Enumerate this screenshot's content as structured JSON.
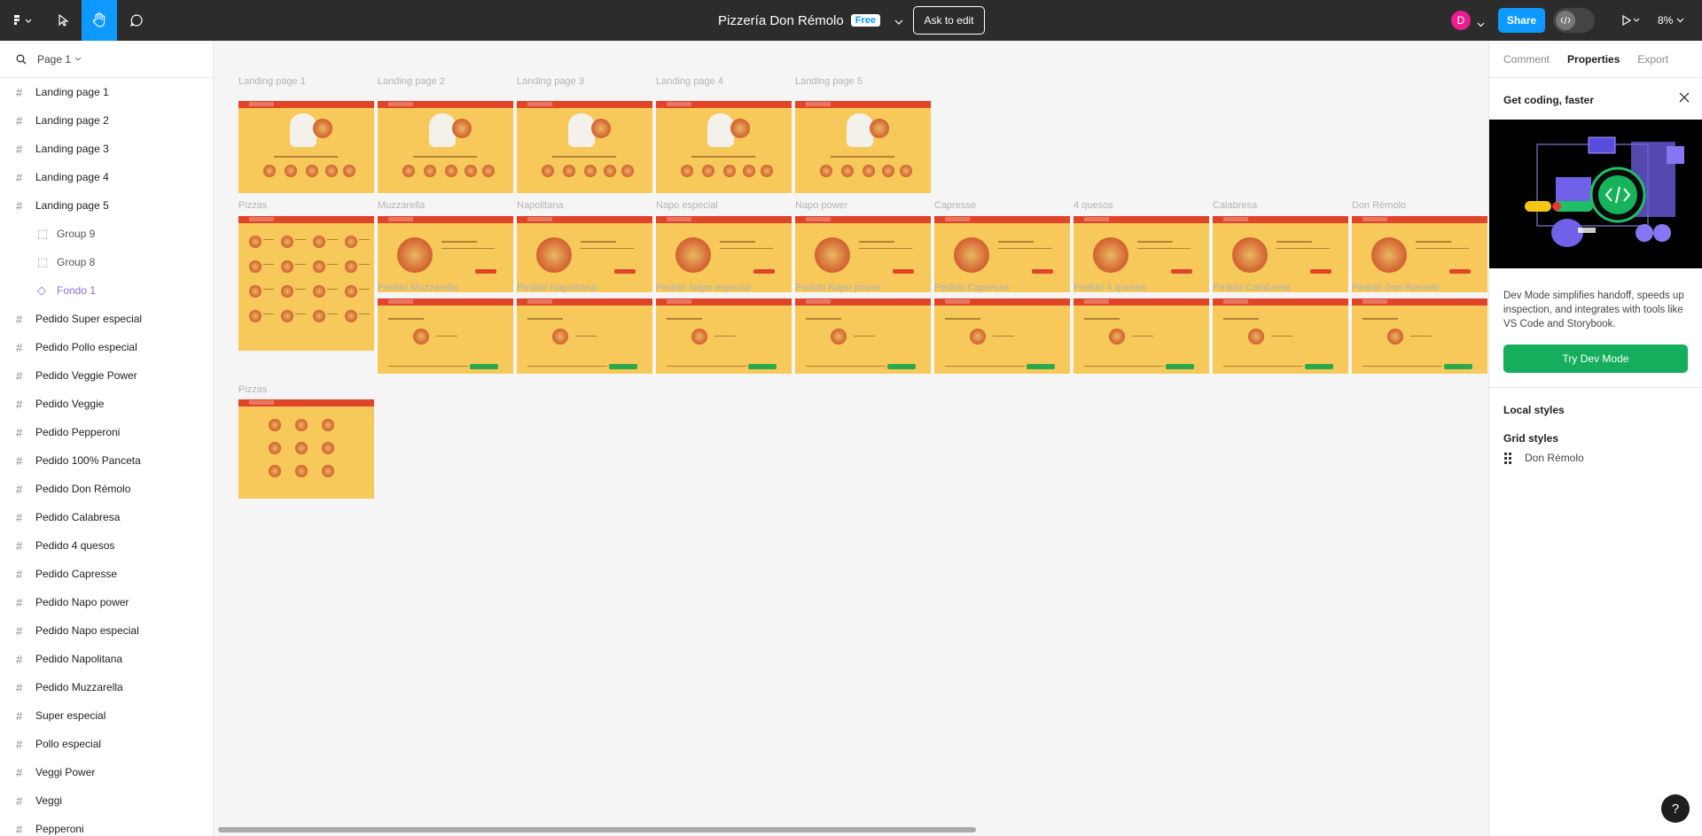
{
  "topbar": {
    "file_title": "Pizzería Don Rémolo",
    "badge": "Free",
    "ask_to_edit": "Ask to edit",
    "avatar_initial": "D",
    "share": "Share",
    "zoom": "8%"
  },
  "left": {
    "page_selector": "Page 1",
    "layers": [
      {
        "label": "Landing page 1",
        "kind": "frame"
      },
      {
        "label": "Landing page 2",
        "kind": "frame"
      },
      {
        "label": "Landing page 3",
        "kind": "frame"
      },
      {
        "label": "Landing page 4",
        "kind": "frame"
      },
      {
        "label": "Landing page 5",
        "kind": "frame"
      },
      {
        "label": "Group 9",
        "kind": "group"
      },
      {
        "label": "Group 8",
        "kind": "group"
      },
      {
        "label": "Fondo 1",
        "kind": "component"
      },
      {
        "label": "Pedido Super especial",
        "kind": "frame"
      },
      {
        "label": "Pedido Pollo especial",
        "kind": "frame"
      },
      {
        "label": "Pedido Veggie Power",
        "kind": "frame"
      },
      {
        "label": "Pedido Veggie",
        "kind": "frame"
      },
      {
        "label": "Pedido Pepperoni",
        "kind": "frame"
      },
      {
        "label": "Pedido 100% Panceta",
        "kind": "frame"
      },
      {
        "label": "Pedido Don Rémolo",
        "kind": "frame"
      },
      {
        "label": "Pedido Calabresa",
        "kind": "frame"
      },
      {
        "label": "Pedido 4 quesos",
        "kind": "frame"
      },
      {
        "label": "Pedido Capresse",
        "kind": "frame"
      },
      {
        "label": "Pedido Napo power",
        "kind": "frame"
      },
      {
        "label": "Pedido Napo especial",
        "kind": "frame"
      },
      {
        "label": "Pedido Napolitana",
        "kind": "frame"
      },
      {
        "label": "Pedido Muzzarella",
        "kind": "frame"
      },
      {
        "label": "Super especial",
        "kind": "frame"
      },
      {
        "label": "Pollo especial",
        "kind": "frame"
      },
      {
        "label": "Veggi Power",
        "kind": "frame"
      },
      {
        "label": "Veggi",
        "kind": "frame"
      },
      {
        "label": "Pepperoni",
        "kind": "frame"
      }
    ]
  },
  "canvas": {
    "row1_labels": [
      "Landing page 1",
      "Landing page 2",
      "Landing page 3",
      "Landing page 4",
      "Landing page 5"
    ],
    "row2_labels": [
      "Pizzas",
      "Muzzarella",
      "Napolitana",
      "Napo especial",
      "Napo power",
      "Capresse",
      "4 quesos",
      "Calabresa",
      "Don Rémolo"
    ],
    "row3_labels": [
      "Pedido Muzzarella",
      "Pedido Napolitana",
      "Pedido Napo especial",
      "Pedido Napo power",
      "Pedido Capresse",
      "Pedido 4 quesos",
      "Pedido Calabresa",
      "Pedido Don Rémolo"
    ],
    "row4_labels": [
      "Pizzas"
    ]
  },
  "right": {
    "tabs": [
      "Comment",
      "Properties",
      "Export"
    ],
    "active_tab": "Properties",
    "promo_title": "Get coding, faster",
    "promo_text": "Dev Mode simplifies handoff, speeds up inspection, and integrates with tools like VS Code and Storybook.",
    "try_button": "Try Dev Mode",
    "local_styles": "Local styles",
    "grid_styles": "Grid styles",
    "grid_style_name": "Don Rémolo"
  },
  "colors": {
    "accent": "#0d99ff",
    "frame_bg": "#f7c85a",
    "frame_header": "#e0452a",
    "dev_green": "#14ae5c"
  }
}
